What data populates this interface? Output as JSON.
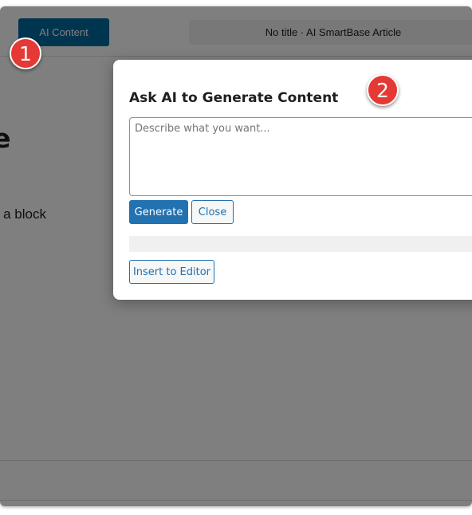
{
  "toolbar": {
    "ai_content_label": "AI Content",
    "document_title": "No title · AI SmartBase Article"
  },
  "canvas": {
    "title_fragment": "tle",
    "hint_fragment": "ose a block"
  },
  "modal": {
    "title": "Ask AI to Generate Content",
    "prompt_placeholder": "Describe what you want...",
    "generate_label": "Generate",
    "close_label": "Close",
    "insert_label": "Insert to Editor"
  },
  "annotations": {
    "step1": "1",
    "step2": "2"
  },
  "colors": {
    "accent": "#2271b1",
    "ai_button": "#006ba1",
    "badge": "#e53935"
  }
}
